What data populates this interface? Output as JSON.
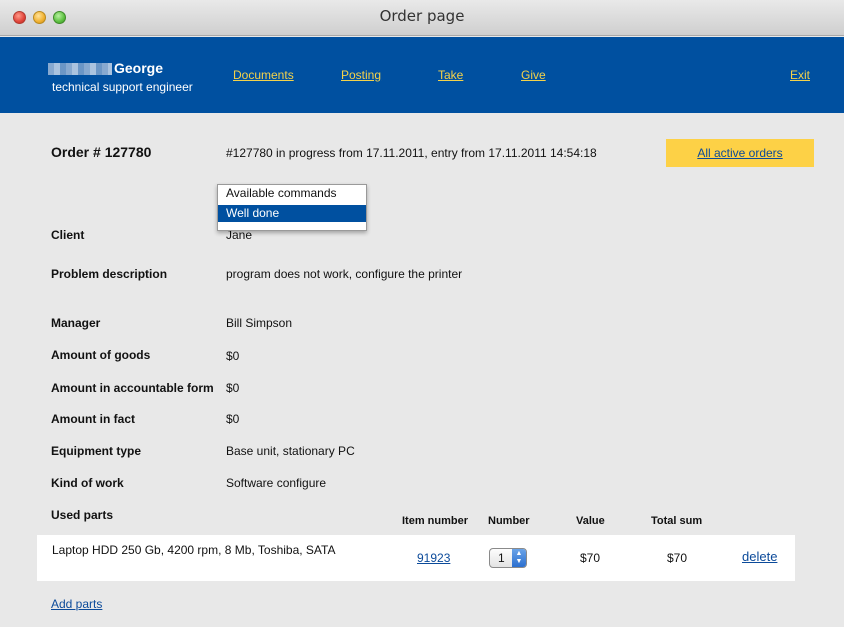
{
  "window": {
    "title": "Order page"
  },
  "user": {
    "name": "George",
    "role": "technical support engineer"
  },
  "nav": {
    "documents": "Documents",
    "posting": "Posting",
    "take": "Take",
    "give": "Give",
    "exit": "Exit"
  },
  "order": {
    "title": "Order # 127780",
    "status": "#127780 in progress from 17.11.2011, entry from 17.11.2011 14:54:18",
    "all_active_orders": "All active orders"
  },
  "commands": {
    "options": [
      "Available commands",
      "Well done"
    ],
    "selected": "Well done"
  },
  "fields": [
    {
      "label": "Client",
      "value": "Jane"
    },
    {
      "label": "Problem description",
      "value": "program does not work, configure the printer"
    },
    {
      "label": "Manager",
      "value": "Bill Simpson"
    },
    {
      "label": "Amount of goods",
      "value": "$0"
    },
    {
      "label": "Amount in accountable form",
      "value": "$0"
    },
    {
      "label": "Amount in fact",
      "value": "$0"
    },
    {
      "label": "Equipment type",
      "value": "Base unit, stationary PC"
    },
    {
      "label": "Kind of work",
      "value": "Software configure"
    }
  ],
  "parts": {
    "label": "Used parts",
    "columns": [
      "Item number",
      "Number",
      "Value",
      "Total sum"
    ],
    "rows": [
      {
        "name": "Laptop HDD 250 Gb, 4200 rpm, 8 Mb, Toshiba, SATA",
        "item_number": "91923",
        "number": "1",
        "value": "$70",
        "total": "$70",
        "delete": "delete"
      }
    ],
    "add_label": "Add parts"
  },
  "colors": {
    "header": "#0050a0",
    "nav_link": "#f4d24a",
    "accent_button": "#fdd146",
    "link": "#0b4a9a"
  }
}
